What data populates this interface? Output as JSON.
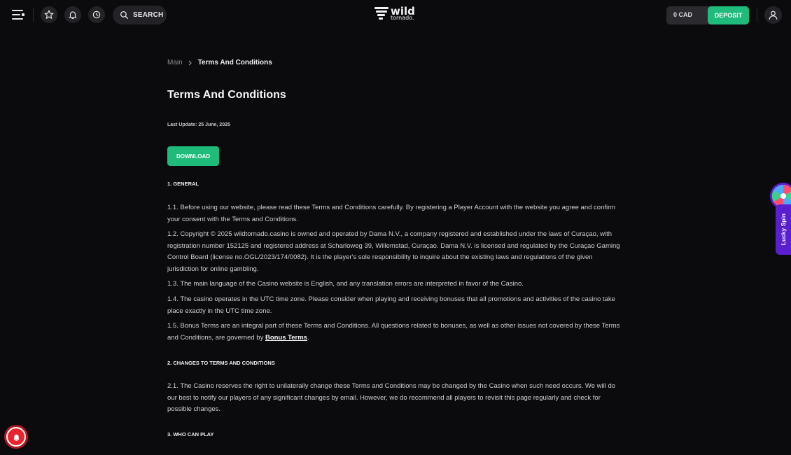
{
  "header": {
    "search_label": "SEARCH",
    "logo_word_1": "wild",
    "logo_word_2": "tornado.",
    "balance": "0 CAD",
    "deposit_label": "DEPOSIT"
  },
  "breadcrumb": {
    "main": "Main",
    "current": "Terms And Conditions"
  },
  "page": {
    "title": "Terms And Conditions",
    "last_update": "Last Update: 25 June, 2025",
    "download_label": "DOWNLOAD"
  },
  "sections": {
    "s1_title": "1. GENERAL",
    "p1_1": "1.1.  Before using our website, please read these Terms and Conditions carefully. By registering a Player Account with the website you agree and confirm your consent with the Terms and Conditions.",
    "p1_2": "1.2.  Copyright © 2025 wildtornado.casino is owned and operated by Dama N.V., a company registered and established under the laws of Curaçao, with registration number 152125 and registered address at Scharloweg 39, Willemstad, Curaçao. Dama N.V. is licensed and regulated by the Curaçao Gaming Control Board (license no.OGL/2023/174/0082). It is the player's sole responsibility to inquire about the existing laws and regulations of the given jurisdiction for online gambling.",
    "p1_3": "1.3.  The main language of the Casino website is English, and any translation errors are interpreted in favor of the Casino.",
    "p1_4": "1.4.  The casino operates in the UTC time zone. Please consider when playing and receiving bonuses that all promotions and activities of the casino take place exactly in the UTC time zone.",
    "p1_5_text": "1.5.  Bonus Terms are an integral part of these Terms and Conditions. All questions related to bonuses, as well as other issues not covered by these Terms and Conditions, are governed by ",
    "p1_5_link": "Bonus Terms",
    "p1_5_end": ".",
    "s2_title": "2. CHANGES TO TERMS AND CONDITIONS",
    "p2_1": "2.1.  The Casino reserves the right to unilaterally change these Terms and Conditions may be changed by the Casino when such need occurs. We will do our best to notify our players of any significant changes by email. However, we do recommend all players to revisit this page regularly and check for possible changes.",
    "s3_title": "3. WHO CAN PLAY"
  },
  "floating": {
    "lucky_spin_label": "Lucky Spin"
  },
  "colors": {
    "accent_green": "#1fbb7a",
    "background": "#0b0b0d",
    "lucky_purple": "#5a1fd0",
    "notification_red": "#e8242f"
  }
}
